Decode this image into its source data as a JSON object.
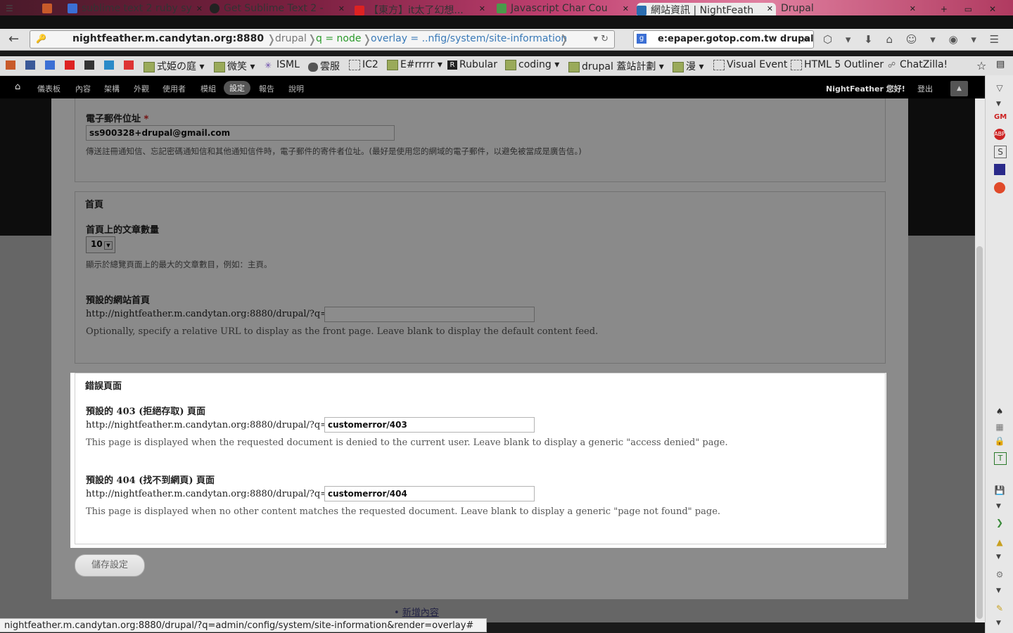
{
  "browser": {
    "tabs": [
      {
        "label": "sublime text 2 ruby sy"
      },
      {
        "label": "Get Sublime Text 2 -"
      },
      {
        "label": "【東方】it太了幻想..."
      },
      {
        "label": "Javascript Char Cou"
      },
      {
        "label": "網站資訊 | NightFeath"
      },
      {
        "label": "Drupal"
      }
    ],
    "url": {
      "host": "nightfeather.m.candytan.org:8880",
      "crumb_drupal": "drupal",
      "crumb_q": "q = node",
      "crumb_overlay": "overlay = ..nfig/system/site-information"
    },
    "search_text": "e:epaper.gotop.com.tw drupal",
    "bookmarks": [
      "式姫の庭",
      "微笑",
      "ISML",
      "雲服",
      "IC2",
      "E#rrrrr",
      "Rubular",
      "coding",
      "drupal 蓋站計劃",
      "漫",
      "Visual Event",
      "HTML 5 Outliner",
      "ChatZilla!"
    ]
  },
  "admin_menu": {
    "items": [
      "儀表板",
      "內容",
      "架構",
      "外觀",
      "使用者",
      "模組",
      "設定",
      "報告",
      "說明"
    ],
    "user_greeting": "NightFeather 您好!",
    "logout": "登出"
  },
  "email": {
    "label": "電子郵件位址",
    "required": "*",
    "value": "ss900328+drupal@gmail.com",
    "description": "傳送註冊通知信、忘記密碼通知信和其他通知信件時，電子郵件的寄件者位址。(最好是使用您的網域的電子郵件，以避免被當成是廣告信。)"
  },
  "front_page": {
    "legend": "首頁",
    "count_label": "首頁上的文章數量",
    "count_value": "10",
    "count_description": "顯示於總覽頁面上的最大的文章數目，例如：主頁。",
    "default_label": "預設的網站首頁",
    "url_prefix": "http://nightfeather.m.candytan.org:8880/drupal/?q=",
    "default_value": "",
    "default_description": "Optionally, specify a relative URL to display as the front page. Leave blank to display the default content feed."
  },
  "error_pages": {
    "legend": "錯誤頁面",
    "e403_label": "預設的 403 (拒絕存取) 頁面",
    "url_prefix": "http://nightfeather.m.candytan.org:8880/drupal/?q=",
    "e403_value": "customerror/403",
    "e403_description": "This page is displayed when the requested document is denied to the current user. Leave blank to display a generic \"access denied\" page.",
    "e404_label": "預設的 404 (找不到網頁) 頁面",
    "e404_value": "customerror/404",
    "e404_description": "This page is displayed when no other content matches the requested document. Leave blank to display a generic \"page not found\" page."
  },
  "save_button": "儲存設定",
  "background_link": "新增內容",
  "status_url": "nightfeather.m.candytan.org:8880/drupal/?q=admin/config/system/site-information&render=overlay#"
}
